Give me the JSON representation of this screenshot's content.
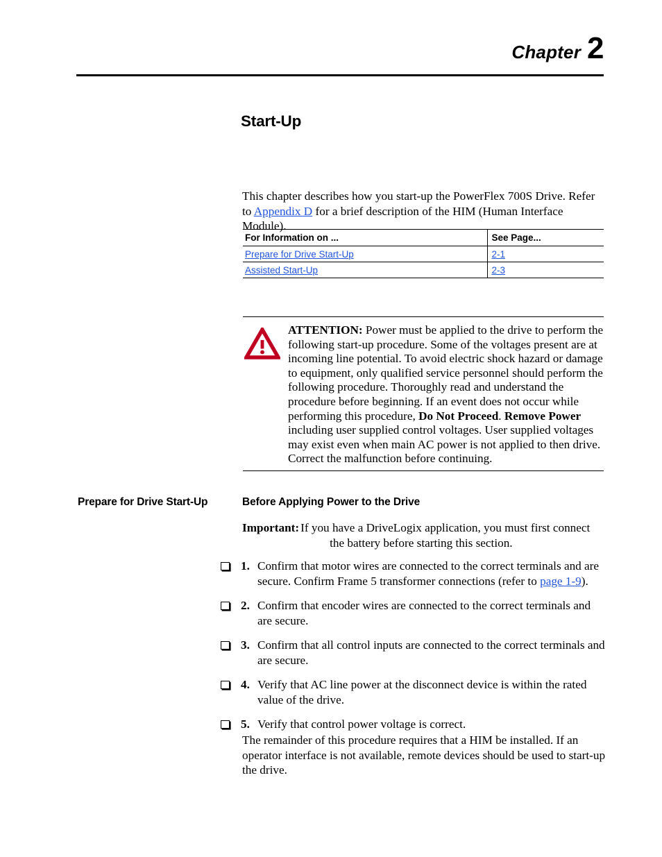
{
  "header": {
    "chapter_word": "Chapter",
    "chapter_number": "2"
  },
  "title": "Start-Up",
  "intro": {
    "before_link": "This chapter describes how you start-up the PowerFlex 700S Drive. Refer to ",
    "link": "Appendix D",
    "after_link": " for a brief description of the HIM (Human Interface Module)."
  },
  "toc": {
    "headers": [
      "For Information on ...",
      "See Page..."
    ],
    "rows": [
      {
        "topic": "Prepare for Drive Start-Up",
        "page": "2-1"
      },
      {
        "topic": "Assisted Start-Up",
        "page": "2-3"
      }
    ]
  },
  "attention": {
    "icon": "warning-triangle-icon",
    "label": "ATTENTION:",
    "part1": "  Power must be applied to the drive to perform the following start-up procedure. Some of the voltages present are at incoming line potential. To avoid electric shock hazard or damage to equipment, only qualified service personnel should perform the following procedure. Thoroughly read and understand the procedure before beginning. If an event does not occur while performing this procedure, ",
    "bold1": "Do Not Proceed",
    "part2": ". ",
    "bold2": "Remove Power",
    "part3": " including user supplied control voltages. User supplied voltages may exist even when main AC power is not applied to then drive. Correct the malfunction before continuing.",
    "icon_color": "#c00020"
  },
  "section": {
    "margin_heading": "Prepare for Drive Start-Up",
    "body_heading": "Before Applying Power to the Drive"
  },
  "important": {
    "label": "Important:",
    "line1": "If you have a DriveLogix application, you must first connect",
    "line2": "the battery before starting this section."
  },
  "checklist": [
    {
      "number": "1.",
      "text_before_link": "Confirm that motor wires are connected to the correct terminals and are secure. Confirm Frame 5 transformer connections (refer to ",
      "link": "page 1-9",
      "text_after_link": ")."
    },
    {
      "number": "2.",
      "text_before_link": "Confirm that encoder wires are connected to the correct terminals and are secure.",
      "link": "",
      "text_after_link": ""
    },
    {
      "number": "3.",
      "text_before_link": "Confirm that all control inputs are connected to the correct terminals and are secure.",
      "link": "",
      "text_after_link": ""
    },
    {
      "number": "4.",
      "text_before_link": "Verify that AC line power at the disconnect device is within the rated value of the drive.",
      "link": "",
      "text_after_link": ""
    },
    {
      "number": "5.",
      "text_before_link": "Verify that control power voltage is correct.",
      "link": "",
      "text_after_link": ""
    }
  ],
  "closing": "The remainder of this procedure requires that a HIM be installed. If an operator interface is not available, remote devices should be used to start-up the drive.",
  "colors": {
    "link": "#2255dd",
    "rule": "#000000",
    "warning": "#c00020"
  }
}
